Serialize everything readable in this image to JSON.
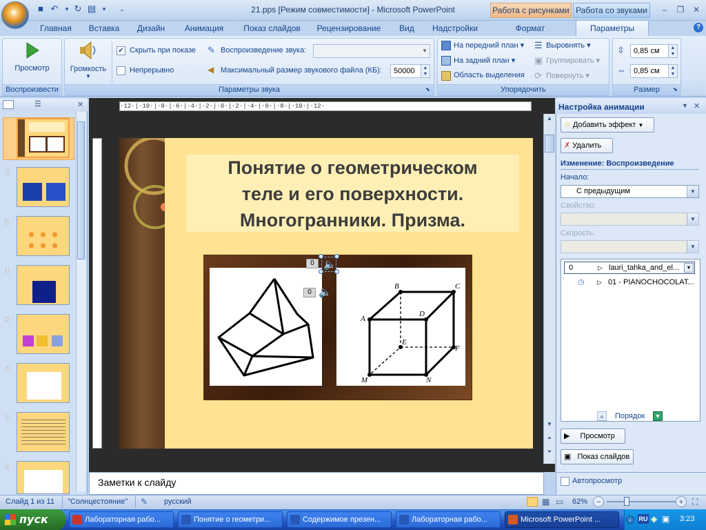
{
  "window": {
    "title": "21.pps [Режим совместимости] - Microsoft PowerPoint",
    "context_tabs": [
      "Работа с рисунками",
      "Работа со звуками"
    ]
  },
  "tabs": [
    "Главная",
    "Вставка",
    "Дизайн",
    "Анимация",
    "Показ слайдов",
    "Рецензирование",
    "Вид",
    "Надстройки",
    "Формат",
    "Параметры"
  ],
  "ribbon": {
    "preview": {
      "label": "Просмотр",
      "group": "Воспроизвести"
    },
    "sound": {
      "volume_label": "Громкость",
      "hide_label": "Скрыть при показе",
      "hide_checked": true,
      "loop_label": "Непрерывно",
      "loop_checked": false,
      "play_label": "Воспроизведение звука:",
      "play_value": "",
      "maxsize_label": "Максимальный размер звукового файла (КБ):",
      "maxsize_value": "50000",
      "group": "Параметры звука"
    },
    "arrange": {
      "front": "На передний план",
      "back": "На задний план",
      "selection": "Область выделения",
      "align": "Выровнять",
      "group_btn": "Группировать",
      "rotate": "Повернуть",
      "group": "Упорядочить"
    },
    "size": {
      "height": "0,85 см",
      "width": "0,85 см",
      "group": "Размер"
    }
  },
  "ruler_text": "·12·|·10·|·8·|·6·|·4·|·2·|·0·|·2·|·4·|·6·|·8·|·10·|·12·",
  "slides": [
    {
      "num": "1"
    },
    {
      "num": "2"
    },
    {
      "num": "3"
    },
    {
      "num": "4"
    },
    {
      "num": "5"
    },
    {
      "num": "6"
    },
    {
      "num": "7"
    },
    {
      "num": "8"
    }
  ],
  "slide": {
    "title_line1": "Понятие о геометрическом",
    "title_line2": "теле и его поверхности.",
    "title_line3": "Многогранники. Призма.",
    "sound1_num": "0",
    "sound2_num": "0",
    "cube_labels": [
      "B",
      "C",
      "A",
      "D",
      "E",
      "F",
      "M",
      "N"
    ]
  },
  "notes": {
    "placeholder": "Заметки к слайду"
  },
  "taskpane": {
    "title": "Настройка анимации",
    "add_effect": "Добавить эффект",
    "remove": "Удалить",
    "change_label": "Изменение: Воспроизведение",
    "start_label": "Начало:",
    "start_value": "С предыдущим",
    "property_label": "Свойство:",
    "speed_label": "Скорость:",
    "items": [
      {
        "num": "0",
        "name": "lauri_tahka_and_el..."
      },
      {
        "num": "",
        "name": "01 - PIANOCHOCOLAT..."
      }
    ],
    "order_label": "Порядок",
    "preview": "Просмотр",
    "slideshow": "Показ слайдов",
    "autopreview": "Автопросмотр"
  },
  "status": {
    "slide": "Слайд 1 из 11",
    "theme": "\"Солнцестояние\"",
    "lang": "русский",
    "zoom": "62%",
    "zoom_level": 0.62
  },
  "taskbar": {
    "start": "пуск",
    "tasks": [
      "Лабораторная рабо...",
      "Понятие о геометри...",
      "Содержимое презен...",
      "Лабораторная рабо...",
      "Microsoft PowerPoint ..."
    ],
    "time": "3:23",
    "lang": "RU"
  }
}
